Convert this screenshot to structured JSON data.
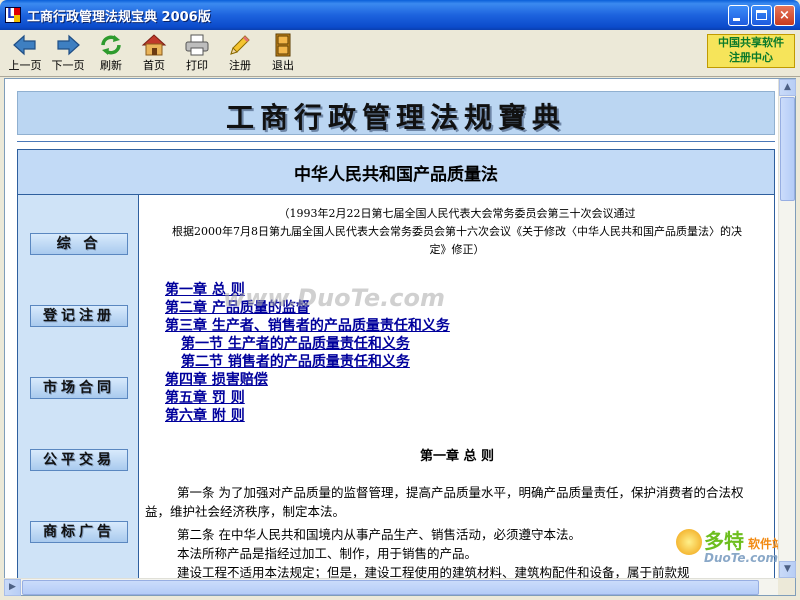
{
  "window": {
    "title": "工商行政管理法规宝典 2006版",
    "controls": {
      "minimize": "minimize",
      "maximize": "maximize",
      "close": "×"
    }
  },
  "toolbar": {
    "items": [
      {
        "label": "上一页",
        "icon": "back-arrow-icon"
      },
      {
        "label": "下一页",
        "icon": "forward-arrow-icon"
      },
      {
        "label": "刷新",
        "icon": "refresh-icon"
      },
      {
        "label": "首页",
        "icon": "home-icon"
      },
      {
        "label": "打印",
        "icon": "printer-icon"
      },
      {
        "label": "注册",
        "icon": "pencil-icon"
      },
      {
        "label": "退出",
        "icon": "exit-door-icon"
      }
    ],
    "badge": {
      "line1": "中国共享软件",
      "line2": "注册中心"
    }
  },
  "banner": {
    "title": "工商行政管理法规寶典"
  },
  "law": {
    "title": "中华人民共和国产品质量法",
    "adoption": [
      "（1993年2月22日第七届全国人民代表大会常务委员会第三十次会议通过",
      "根据2000年7月8日第九届全国人民代表大会常务委员会第十六次会议《关于修改〈中华人民共和国产品质量法〉的决",
      "定》修正）"
    ],
    "toc": [
      "第一章 总 则",
      "第二章 产品质量的监督",
      "第三章 生产者、销售者的产品质量责任和义务",
      "第一节 生产者的产品质量责任和义务",
      "第二节 销售者的产品质量责任和义务",
      "第四章 损害赔偿",
      "第五章 罚 则",
      "第六章 附 则"
    ],
    "chapter_heading": "第一章 总 则",
    "paragraphs": [
      "第一条 为了加强对产品质量的监督管理，提高产品质量水平，明确产品质量责任，保护消费者的合法权益，维护社会经济秩序，制定本法。",
      "第二条 在中华人民共和国境内从事产品生产、销售活动，必须遵守本法。",
      "本法所称产品是指经过加工、制作，用于销售的产品。",
      "建设工程不适用本法规定；但是，建设工程使用的建筑材料、建筑构配件和设备，属于前款规"
    ]
  },
  "sidebar": {
    "items": [
      "综 合",
      "登记注册",
      "市场合同",
      "公平交易",
      "商标广告"
    ]
  },
  "overlays": {
    "watermark": "www.DuoTe.com",
    "corner_logo": {
      "big": "多特",
      "small": "软件站",
      "eng": "DuoTe.com"
    }
  },
  "colors": {
    "titlebar": "#0A5FD9",
    "link": "#00009C",
    "panel_blue": "#C2DAF6"
  }
}
